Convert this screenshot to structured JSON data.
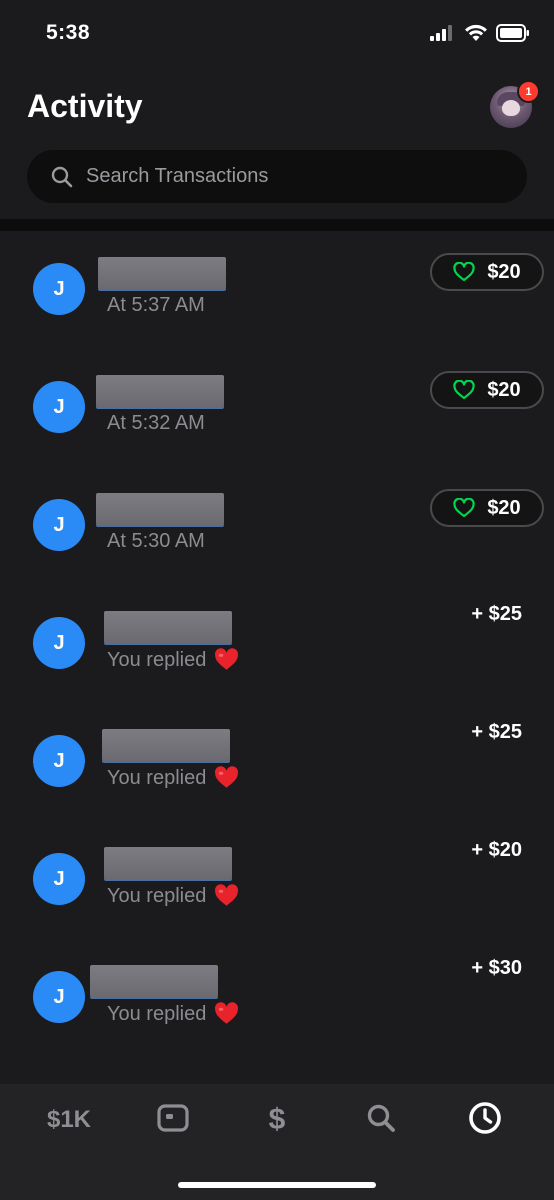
{
  "status_bar": {
    "time": "5:38"
  },
  "header": {
    "title": "Activity",
    "notification_count": "1"
  },
  "search": {
    "placeholder": "Search Transactions"
  },
  "transactions": [
    {
      "avatar_letter": "J",
      "subtitle": "At 5:37 AM",
      "amount": "$20",
      "style": "pill"
    },
    {
      "avatar_letter": "J",
      "subtitle": "At 5:32 AM",
      "amount": "$20",
      "style": "pill"
    },
    {
      "avatar_letter": "J",
      "subtitle": "At 5:30 AM",
      "amount": "$20",
      "style": "pill"
    },
    {
      "avatar_letter": "J",
      "subtitle": "You replied",
      "amount": "+ $25",
      "style": "plain"
    },
    {
      "avatar_letter": "J",
      "subtitle": "You replied",
      "amount": "+ $25",
      "style": "plain"
    },
    {
      "avatar_letter": "J",
      "subtitle": "You replied",
      "amount": "+ $20",
      "style": "plain"
    },
    {
      "avatar_letter": "J",
      "subtitle": "You replied",
      "amount": "+ $30",
      "style": "plain"
    }
  ],
  "bottom_nav": {
    "balance_label": "$1K",
    "pay_label": "$"
  },
  "colors": {
    "background": "#1b1b1d",
    "avatar_blue": "#2a8af6",
    "heart_green": "#00d64f",
    "badge_red": "#ff3b30"
  },
  "icons": [
    "signal-icon",
    "wifi-icon",
    "battery-icon",
    "search-icon",
    "heart-outline-icon",
    "red-heart-emoji-icon",
    "card-icon",
    "search-nav-icon",
    "clock-icon"
  ]
}
